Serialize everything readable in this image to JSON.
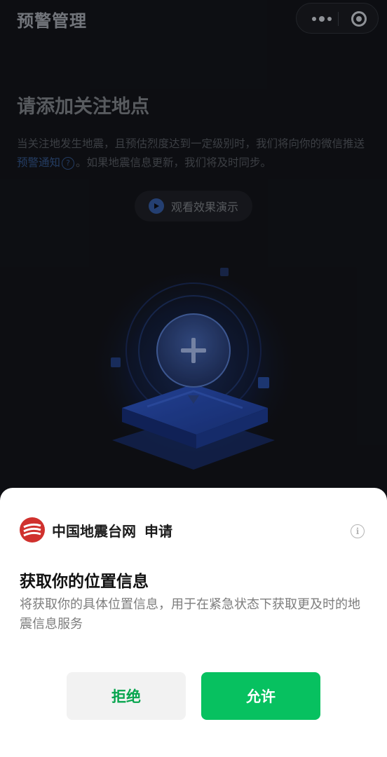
{
  "nav": {
    "title": "预警管理",
    "more_icon": "more-dots-icon",
    "close_icon": "target-circle-icon"
  },
  "page": {
    "heading": "请添加关注地点",
    "desc_part1": "当关注地发生地震，且预估烈度达到一定级别时，我们将向你的微信推送",
    "desc_link": "预警通知",
    "desc_help": "?",
    "desc_part2": "。如果地震信息更新，我们将及时同步。",
    "demo_button": "观看效果演示",
    "demo_icon": "play-icon"
  },
  "sheet": {
    "app_name": "中国地震台网",
    "apply": "申请",
    "info_icon": "info-icon",
    "info_glyph": "i",
    "title": "获取你的位置信息",
    "desc": "将获取你的具体位置信息，用于在紧急状态下获取更及时的地震信息服务",
    "deny": "拒绝",
    "allow": "允许"
  },
  "colors": {
    "accent_green": "#07c160",
    "deny_text": "#07a54e",
    "link_blue": "#2d4a78",
    "logo_red": "#d0312d"
  }
}
